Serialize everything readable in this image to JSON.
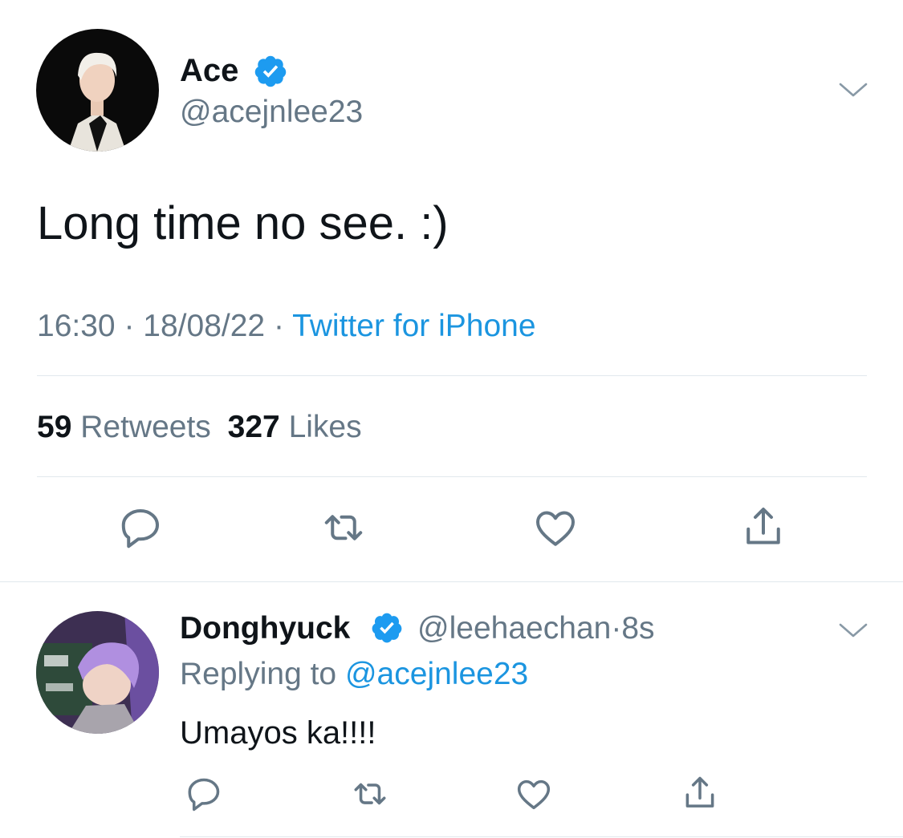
{
  "tweet": {
    "author_name": "Ace",
    "handle": "@acejnlee23",
    "text": "Long time no see. :)",
    "time": "16:30",
    "date": "18/08/22",
    "source": "Twitter for iPhone",
    "separator": "·",
    "retweet_count": "59",
    "retweet_label": "Retweets",
    "like_count": "327",
    "like_label": "Likes",
    "icons": [
      "reply-icon",
      "retweet-icon",
      "like-icon",
      "share-icon"
    ]
  },
  "reply": {
    "author_name": "Donghyuck",
    "handle": "@leehaechan",
    "separator": "·",
    "age": "8s",
    "replying_label": "Replying to",
    "replying_handle": "@acejnlee23",
    "text": "Umayos ka!!!!",
    "icons": [
      "reply-icon",
      "retweet-icon",
      "like-icon",
      "share-icon"
    ]
  },
  "colors": {
    "accent": "#1b95e0",
    "verified": "#1d9bf0",
    "secondary_text": "#657786",
    "icon": "#657786",
    "divider": "#e1e8ed"
  }
}
